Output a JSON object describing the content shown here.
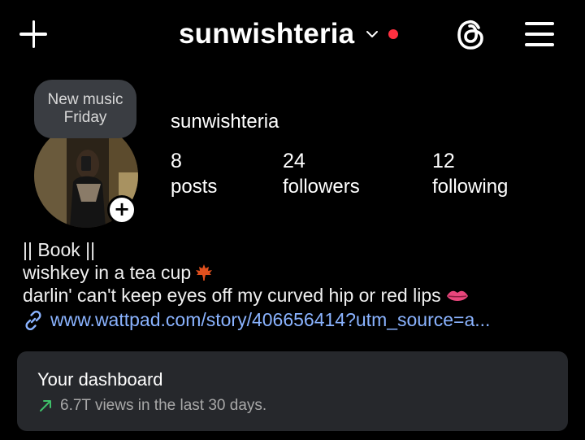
{
  "topbar": {
    "username": "sunwishteria",
    "icons": {
      "create": "plus-icon",
      "switch_account": "chevron-down-icon",
      "threads": "threads-icon",
      "menu": "hamburger-menu-icon"
    }
  },
  "profile": {
    "note": "New music Friday",
    "display_name": "sunwishteria",
    "stats": [
      {
        "value": "8",
        "label": "posts"
      },
      {
        "value": "24",
        "label": "followers"
      },
      {
        "value": "12",
        "label": "following"
      }
    ]
  },
  "bio": {
    "line1": "|| Book ||",
    "line2": "wishkey in a tea cup",
    "line3": "darlin' can't keep eyes off my curved hip or red lips",
    "link": "www.wattpad.com/story/406656414?utm_source=a..."
  },
  "dashboard": {
    "title": "Your dashboard",
    "subtitle": "6.7T views in the last 30 days."
  },
  "colors": {
    "background": "#000000",
    "notification_dot": "#ff3040",
    "link": "#8ab3ff",
    "card": "#26282c",
    "trend": "#3fbf6a"
  }
}
